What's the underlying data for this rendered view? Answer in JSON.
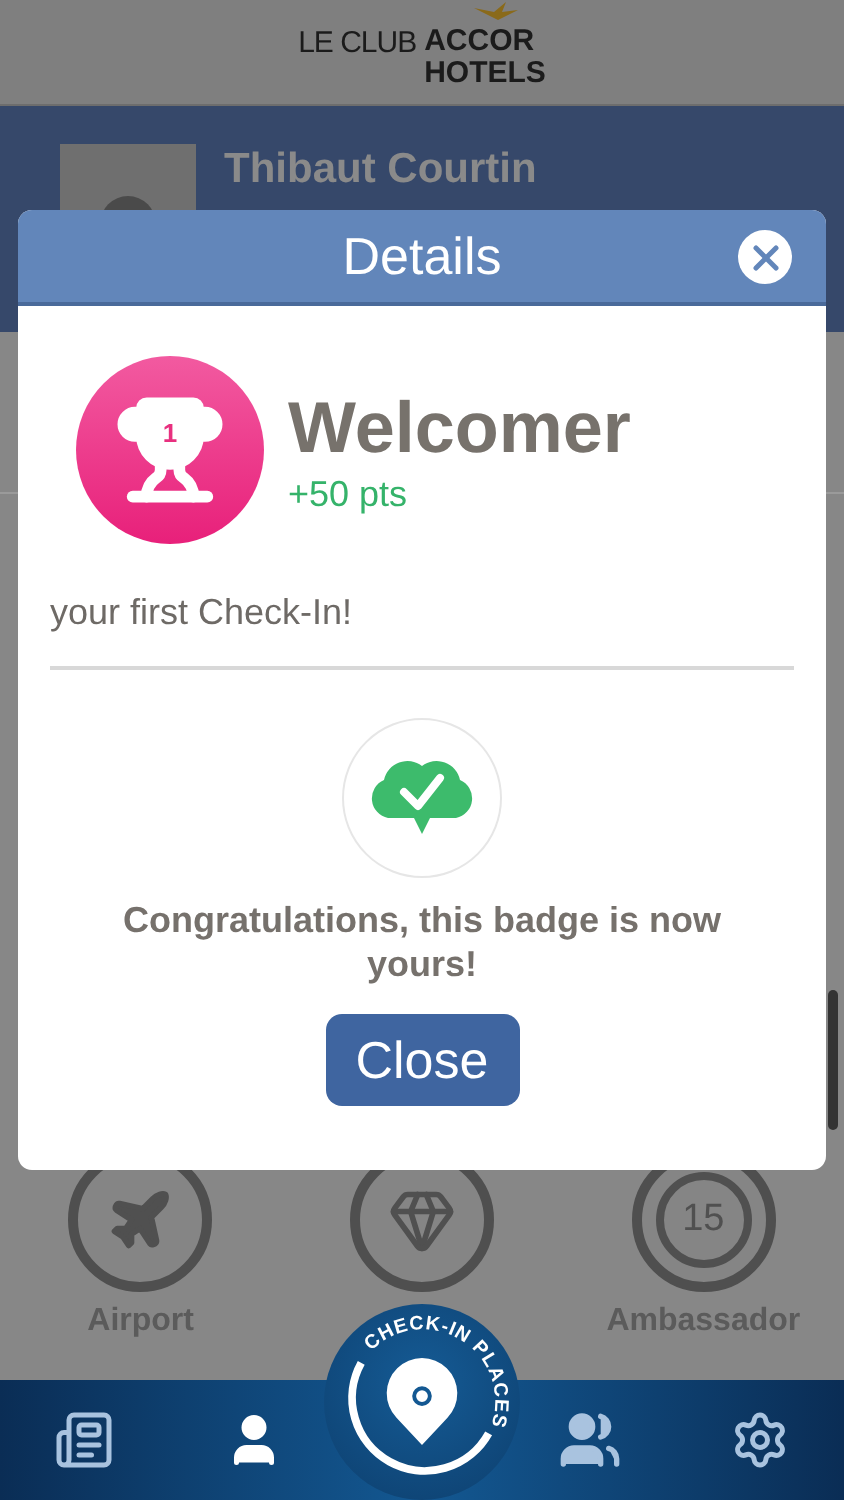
{
  "header": {
    "logo": {
      "part_1": "LE CLUB",
      "part_2": "ACCOR",
      "part_3": "HOTELS"
    }
  },
  "profile": {
    "name": "Thibaut Courtin"
  },
  "badges": [
    {
      "kind": "plane",
      "label": "Airport"
    },
    {
      "kind": "diamond"
    },
    {
      "kind": "count",
      "count": "15",
      "label": "Ambassador"
    }
  ],
  "modal": {
    "title": "Details",
    "badge_rank": "1",
    "badge_name": "Welcomer",
    "points": "+50 pts",
    "description": "your first Check-In!",
    "message": "Congratulations, this badge is now yours!",
    "button": "Close"
  },
  "nav": [
    {
      "kind": "news",
      "selected": false
    },
    {
      "kind": "profile",
      "selected": true
    },
    {
      "kind": "checkin",
      "label": "CHECK-IN PLACES",
      "selected": false
    },
    {
      "kind": "community",
      "selected": false
    },
    {
      "kind": "settings",
      "selected": false
    }
  ]
}
